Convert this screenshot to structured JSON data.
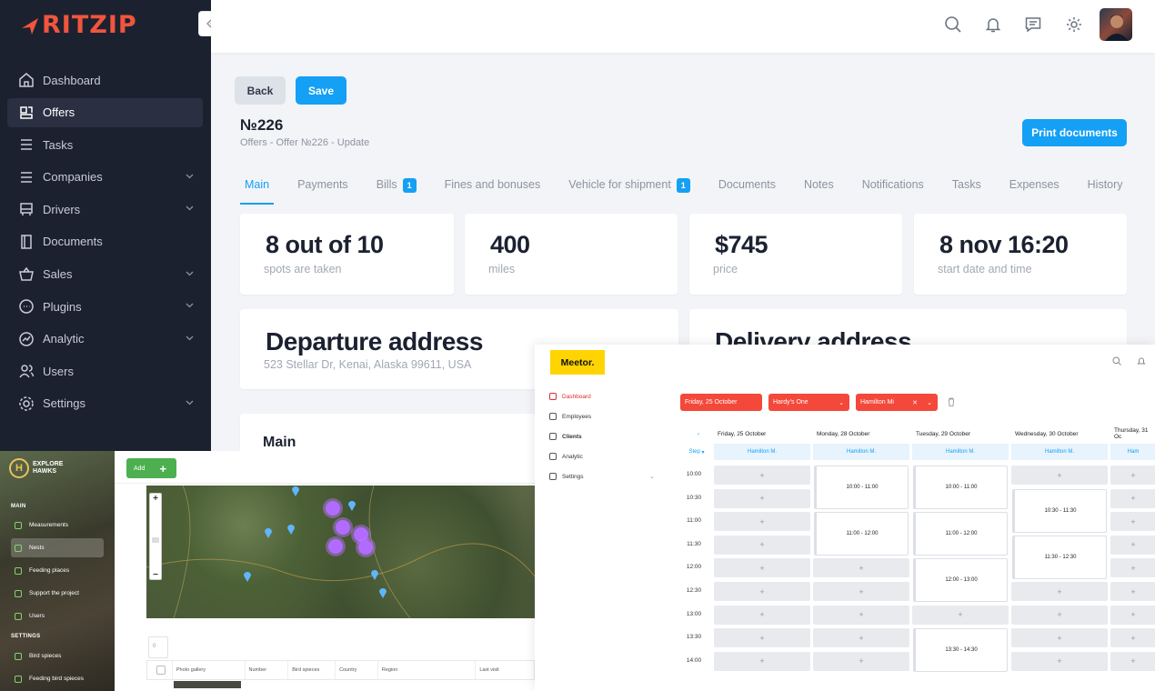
{
  "brand": {
    "name": "RITZIP",
    "accent": "#f0553d",
    "primary": "#14a0f4"
  },
  "sidebar": {
    "collapse_icon": "double-chevron-left-icon",
    "items": [
      {
        "label": "Dashboard",
        "icon": "home-icon",
        "has_chevron": false,
        "active": false
      },
      {
        "label": "Offers",
        "icon": "offers-icon",
        "has_chevron": false,
        "active": true
      },
      {
        "label": "Tasks",
        "icon": "list-icon",
        "has_chevron": false,
        "active": false
      },
      {
        "label": "Companies",
        "icon": "list-icon",
        "has_chevron": true,
        "active": false
      },
      {
        "label": "Drivers",
        "icon": "bus-icon",
        "has_chevron": true,
        "active": false
      },
      {
        "label": "Documents",
        "icon": "book-icon",
        "has_chevron": false,
        "active": false
      },
      {
        "label": "Sales",
        "icon": "basket-icon",
        "has_chevron": true,
        "active": false
      },
      {
        "label": "Plugins",
        "icon": "chat-icon",
        "has_chevron": true,
        "active": false
      },
      {
        "label": "Analytic",
        "icon": "chart-icon",
        "has_chevron": true,
        "active": false
      },
      {
        "label": "Users",
        "icon": "users-icon",
        "has_chevron": false,
        "active": false
      },
      {
        "label": "Settings",
        "icon": "gear-icon",
        "has_chevron": true,
        "active": false
      }
    ]
  },
  "topbar": {
    "icons": [
      "search-icon",
      "bell-icon",
      "message-icon",
      "settings-icon"
    ]
  },
  "actions": {
    "back": "Back",
    "save": "Save",
    "print": "Print documents"
  },
  "page": {
    "title": "№226",
    "breadcrumb": "Offers - Offer №226 - Update"
  },
  "tabs": [
    {
      "label": "Main",
      "badge": null
    },
    {
      "label": "Payments",
      "badge": null
    },
    {
      "label": "Bills",
      "badge": "1"
    },
    {
      "label": "Fines and bonuses",
      "badge": null
    },
    {
      "label": "Vehicle for shipment",
      "badge": "1"
    },
    {
      "label": "Documents",
      "badge": null
    },
    {
      "label": "Notes",
      "badge": null
    },
    {
      "label": "Notifications",
      "badge": null
    },
    {
      "label": "Tasks",
      "badge": null
    },
    {
      "label": "Expenses",
      "badge": null
    },
    {
      "label": "History",
      "badge": null
    }
  ],
  "stats": [
    {
      "value": "8 out of 10",
      "label": "spots are taken"
    },
    {
      "value": "400",
      "label": "miles"
    },
    {
      "value": "$745",
      "label": "price"
    },
    {
      "value": "8 nov 16:20",
      "label": "start date and time"
    }
  ],
  "departure": {
    "title": "Departure address",
    "value": "523 Stellar Dr, Kenai, Alaska 99611, USA"
  },
  "delivery": {
    "title": "Delivery address"
  },
  "main_section": {
    "title": "Main"
  },
  "explore": {
    "logo": [
      "EXPLORE",
      "HAWKS"
    ],
    "section_main": "MAIN",
    "section_settings": "SETTINGS",
    "items": [
      "Measurements",
      "Nests",
      "Feeding places",
      "Support the project",
      "Users"
    ],
    "settings_items": [
      "Bird spieces",
      "Feeding bird spieces"
    ],
    "add": "Add",
    "filter": "0",
    "columns": [
      "Photo gallery",
      "Number",
      "Bird spieces",
      "Country",
      "Region",
      "Last visit"
    ]
  },
  "meetor": {
    "logo": "Meetor.",
    "nav": [
      "Dashboard",
      "Employees",
      "Clients",
      "Analytic",
      "Settings"
    ],
    "filters": [
      "Friday, 25 October",
      "Hardy's One",
      "Hamilton Mi"
    ],
    "step": "Step",
    "days": [
      "Friday, 25 October",
      "Monday, 28 October",
      "Tuesday, 29 October",
      "Wednesday, 30 October",
      "Thursday, 31 Oc"
    ],
    "staff": [
      "Hamilton M.",
      "Hamilton M.",
      "Hamilton M.",
      "Hamilton M.",
      "Ham"
    ],
    "times": [
      "10:00",
      "10:30",
      "11:00",
      "11:30",
      "12:00",
      "12:30",
      "13:00",
      "13:30",
      "14:00"
    ],
    "bookings": [
      "10:00 - 11:00",
      "11:00 - 12:00",
      "10:00 - 11:00",
      "11:00 - 12:00",
      "12:00 - 13:00",
      "13:30 - 14:30",
      "10:30 - 11:30",
      "11:30 - 12:30"
    ]
  }
}
